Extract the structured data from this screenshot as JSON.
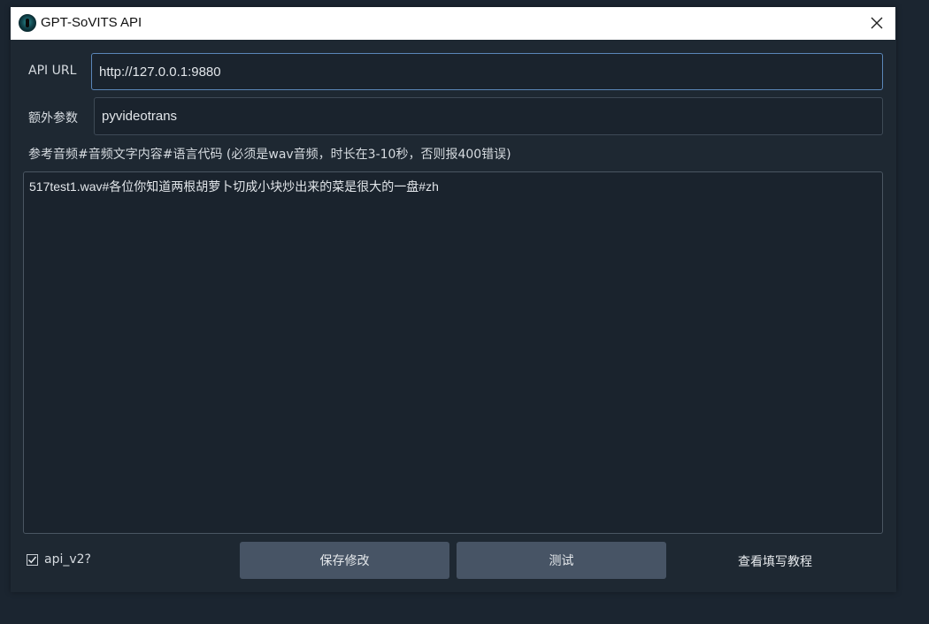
{
  "window": {
    "title": "GPT-SoVITS API"
  },
  "form": {
    "api_url_label": "API URL",
    "api_url_value": "http://127.0.0.1:9880",
    "extra_params_label": "额外参数",
    "extra_params_value": "pyvideotrans",
    "ref_audio_hint": "参考音频#音频文字内容#语言代码 (必须是wav音频，时长在3-10秒，否则报400错误)",
    "ref_audio_text": "517test1.wav#各位你知道两根胡萝卜切成小块炒出来的菜是很大的一盘#zh"
  },
  "footer": {
    "checkbox_label": "api_v2?",
    "checkbox_checked": true,
    "save_button": "保存修改",
    "test_button": "测试",
    "tutorial_link": "查看填写教程"
  },
  "icons": {
    "app": "app-logo-icon",
    "close": "close-icon",
    "check": "checkmark-icon"
  },
  "colors": {
    "background": "#1b2530",
    "panel": "#1e2832",
    "button": "#475465",
    "focus_border": "#5a86b8"
  }
}
